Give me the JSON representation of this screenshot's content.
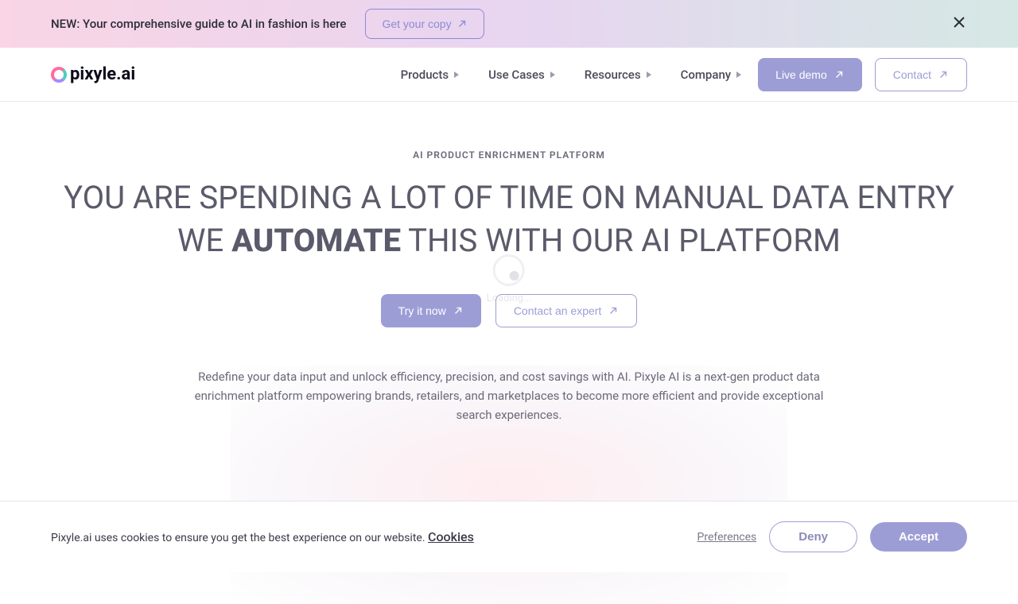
{
  "banner": {
    "text": "NEW: Your comprehensive guide to AI in fashion is here",
    "cta": "Get your copy"
  },
  "logo": {
    "text": "pixyle.ai"
  },
  "nav": {
    "items": [
      {
        "label": "Products"
      },
      {
        "label": "Use Cases"
      },
      {
        "label": "Resources"
      },
      {
        "label": "Company"
      }
    ],
    "live_demo": "Live demo",
    "contact": "Contact"
  },
  "hero": {
    "eyebrow": "AI PRODUCT ENRICHMENT PLATFORM",
    "title_line1": "YOU ARE SPENDING A LOT OF TIME ON MANUAL DATA ENTRY",
    "title_line2_prefix": "WE ",
    "title_line2_bold": "AUTOMATE",
    "title_line2_suffix": " THIS WITH OUR AI PLATFORM",
    "try_now": "Try it now",
    "contact_expert": "Contact an expert",
    "description": "Redefine your data input and unlock efficiency, precision, and cost savings with AI. Pixyle AI is a next-gen product data enrichment platform empowering brands, retailers, and marketplaces to become more efficient and provide exceptional search experiences."
  },
  "loading": {
    "text": "Loading..."
  },
  "cookies": {
    "text": "Pixyle.ai uses cookies to ensure you get the best experience on our website. ",
    "link": "Cookies",
    "preferences": "Preferences",
    "deny": "Deny",
    "accept": "Accept"
  }
}
